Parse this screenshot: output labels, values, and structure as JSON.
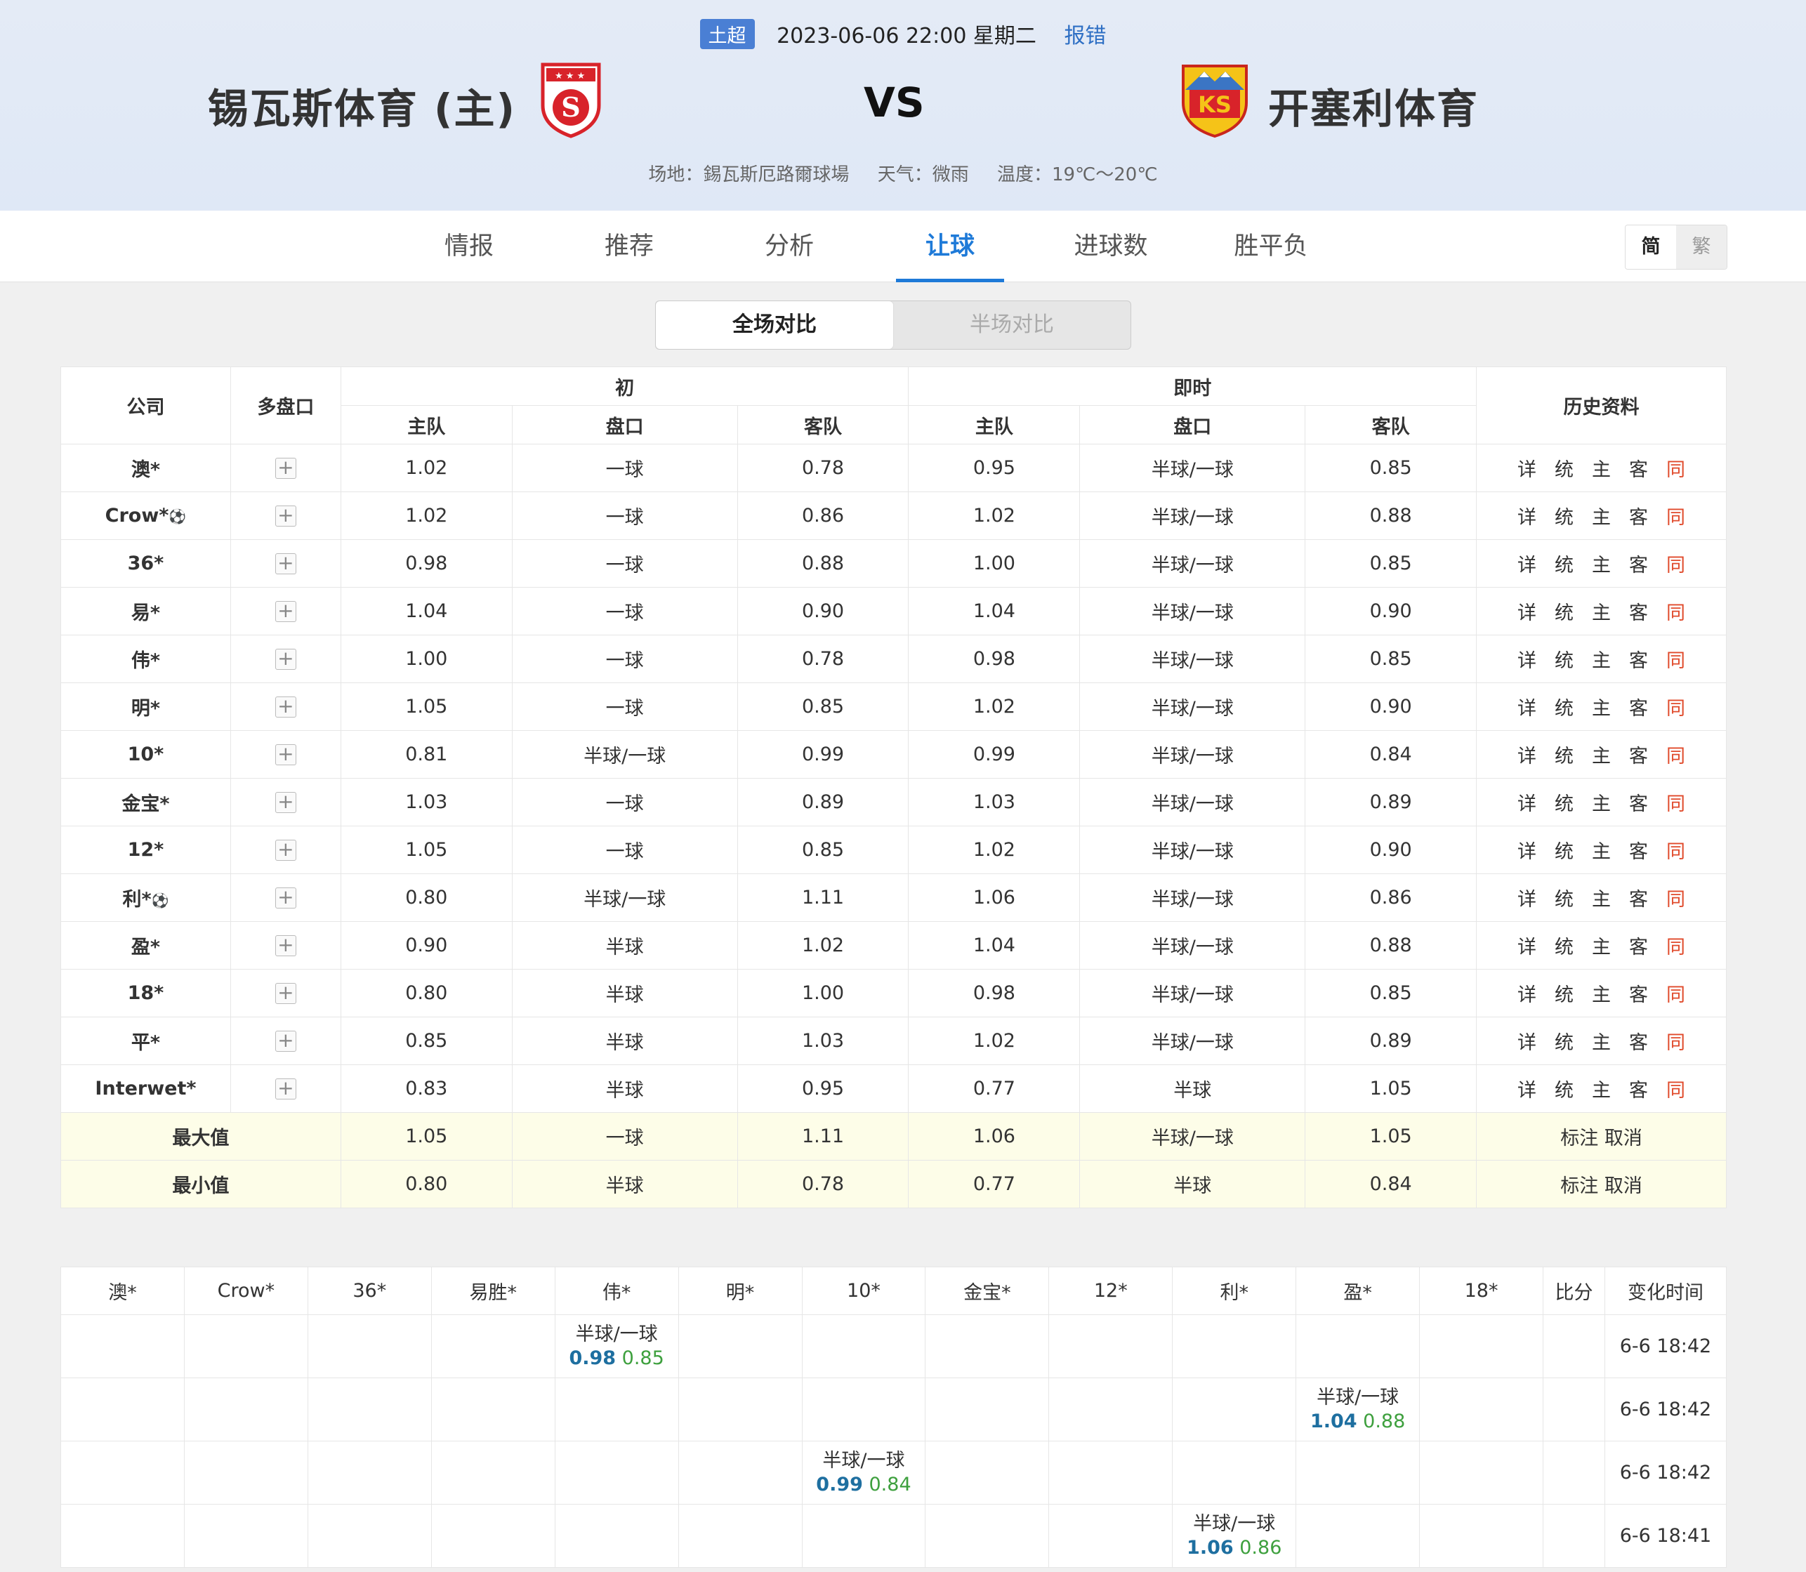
{
  "header": {
    "league": "土超",
    "datetime": "2023-06-06 22:00 星期二",
    "report": "报错",
    "home_team": "锡瓦斯体育 (主)",
    "away_team": "开塞利体育",
    "vs": "VS",
    "venue": "场地：錫瓦斯厄路爾球場",
    "weather": "天气：微雨",
    "temperature": "温度：19℃～20℃"
  },
  "tabs": [
    "情报",
    "推荐",
    "分析",
    "让球",
    "进球数",
    "胜平负"
  ],
  "active_tab": "让球",
  "lang": {
    "simp": "简",
    "trad": "繁"
  },
  "segment": {
    "full": "全场对比",
    "half": "半场对比"
  },
  "table_head": {
    "company": "公司",
    "multi": "多盘口",
    "initial": "初",
    "live": "即时",
    "history": "历史资料",
    "home": "主队",
    "line": "盘口",
    "away": "客队"
  },
  "history_links": [
    "详",
    "统",
    "主",
    "客",
    "同"
  ],
  "rows": [
    {
      "company": "澳*",
      "ball": false,
      "i_home": "1.02",
      "i_line": "一球",
      "i_away": "0.78",
      "l_home": "0.95",
      "l_line": "半球/一球",
      "l_away": "0.85"
    },
    {
      "company": "Crow*",
      "ball": true,
      "i_home": "1.02",
      "i_line": "一球",
      "i_away": "0.86",
      "l_home": "1.02",
      "l_line": "半球/一球",
      "l_away": "0.88"
    },
    {
      "company": "36*",
      "ball": false,
      "i_home": "0.98",
      "i_line": "一球",
      "i_away": "0.88",
      "l_home": "1.00",
      "l_line": "半球/一球",
      "l_away": "0.85"
    },
    {
      "company": "易*",
      "ball": false,
      "i_home": "1.04",
      "i_line": "一球",
      "i_away": "0.90",
      "l_home": "1.04",
      "l_line": "半球/一球",
      "l_away": "0.90"
    },
    {
      "company": "伟*",
      "ball": false,
      "i_home": "1.00",
      "i_line": "一球",
      "i_away": "0.78",
      "l_home": "0.98",
      "l_line": "半球/一球",
      "l_away": "0.85"
    },
    {
      "company": "明*",
      "ball": false,
      "i_home": "1.05",
      "i_line": "一球",
      "i_away": "0.85",
      "l_home": "1.02",
      "l_line": "半球/一球",
      "l_away": "0.90"
    },
    {
      "company": "10*",
      "ball": false,
      "i_home": "0.81",
      "i_line": "半球/一球",
      "i_away": "0.99",
      "l_home": "0.99",
      "l_line": "半球/一球",
      "l_away": "0.84"
    },
    {
      "company": "金宝*",
      "ball": false,
      "i_home": "1.03",
      "i_line": "一球",
      "i_away": "0.89",
      "l_home": "1.03",
      "l_line": "半球/一球",
      "l_away": "0.89"
    },
    {
      "company": "12*",
      "ball": false,
      "i_home": "1.05",
      "i_line": "一球",
      "i_away": "0.85",
      "l_home": "1.02",
      "l_line": "半球/一球",
      "l_away": "0.90"
    },
    {
      "company": "利*",
      "ball": true,
      "i_home": "0.80",
      "i_line": "半球/一球",
      "i_away": "1.11",
      "l_home": "1.06",
      "l_line": "半球/一球",
      "l_away": "0.86"
    },
    {
      "company": "盈*",
      "ball": false,
      "i_home": "0.90",
      "i_line": "半球",
      "i_away": "1.02",
      "l_home": "1.04",
      "l_line": "半球/一球",
      "l_away": "0.88"
    },
    {
      "company": "18*",
      "ball": false,
      "i_home": "0.80",
      "i_line": "半球",
      "i_away": "1.00",
      "l_home": "0.98",
      "l_line": "半球/一球",
      "l_away": "0.85"
    },
    {
      "company": "平*",
      "ball": false,
      "i_home": "0.85",
      "i_line": "半球",
      "i_away": "1.03",
      "l_home": "1.02",
      "l_line": "半球/一球",
      "l_away": "0.89"
    },
    {
      "company": "Interwet*",
      "ball": false,
      "i_home": "0.83",
      "i_line": "半球",
      "i_away": "0.95",
      "l_home": "0.77",
      "l_line": "半球",
      "l_away": "1.05"
    }
  ],
  "stats": [
    {
      "label": "最大值",
      "i_home": "1.05",
      "i_line": "一球",
      "i_away": "1.11",
      "l_home": "1.06",
      "l_line": "半球/一球",
      "l_away": "1.05",
      "action": "标注 取消"
    },
    {
      "label": "最小值",
      "i_home": "0.80",
      "i_line": "半球",
      "i_away": "0.78",
      "l_home": "0.77",
      "l_line": "半球",
      "l_away": "0.84",
      "action": "标注 取消"
    }
  ],
  "change_head": [
    "澳*",
    "Crow*",
    "36*",
    "易胜*",
    "伟*",
    "明*",
    "10*",
    "金宝*",
    "12*",
    "利*",
    "盈*",
    "18*",
    "比分",
    "变化时间"
  ],
  "changes": [
    {
      "col": 4,
      "line": "半球/一球",
      "home": "0.98",
      "away": "0.85",
      "time": "6-6 18:42"
    },
    {
      "col": 10,
      "line": "半球/一球",
      "home": "1.04",
      "away": "0.88",
      "time": "6-6 18:42"
    },
    {
      "col": 6,
      "line": "半球/一球",
      "home": "0.99",
      "away": "0.84",
      "time": "6-6 18:42"
    },
    {
      "col": 9,
      "line": "半球/一球",
      "home": "1.06",
      "away": "0.86",
      "time": "6-6 18:41"
    }
  ]
}
